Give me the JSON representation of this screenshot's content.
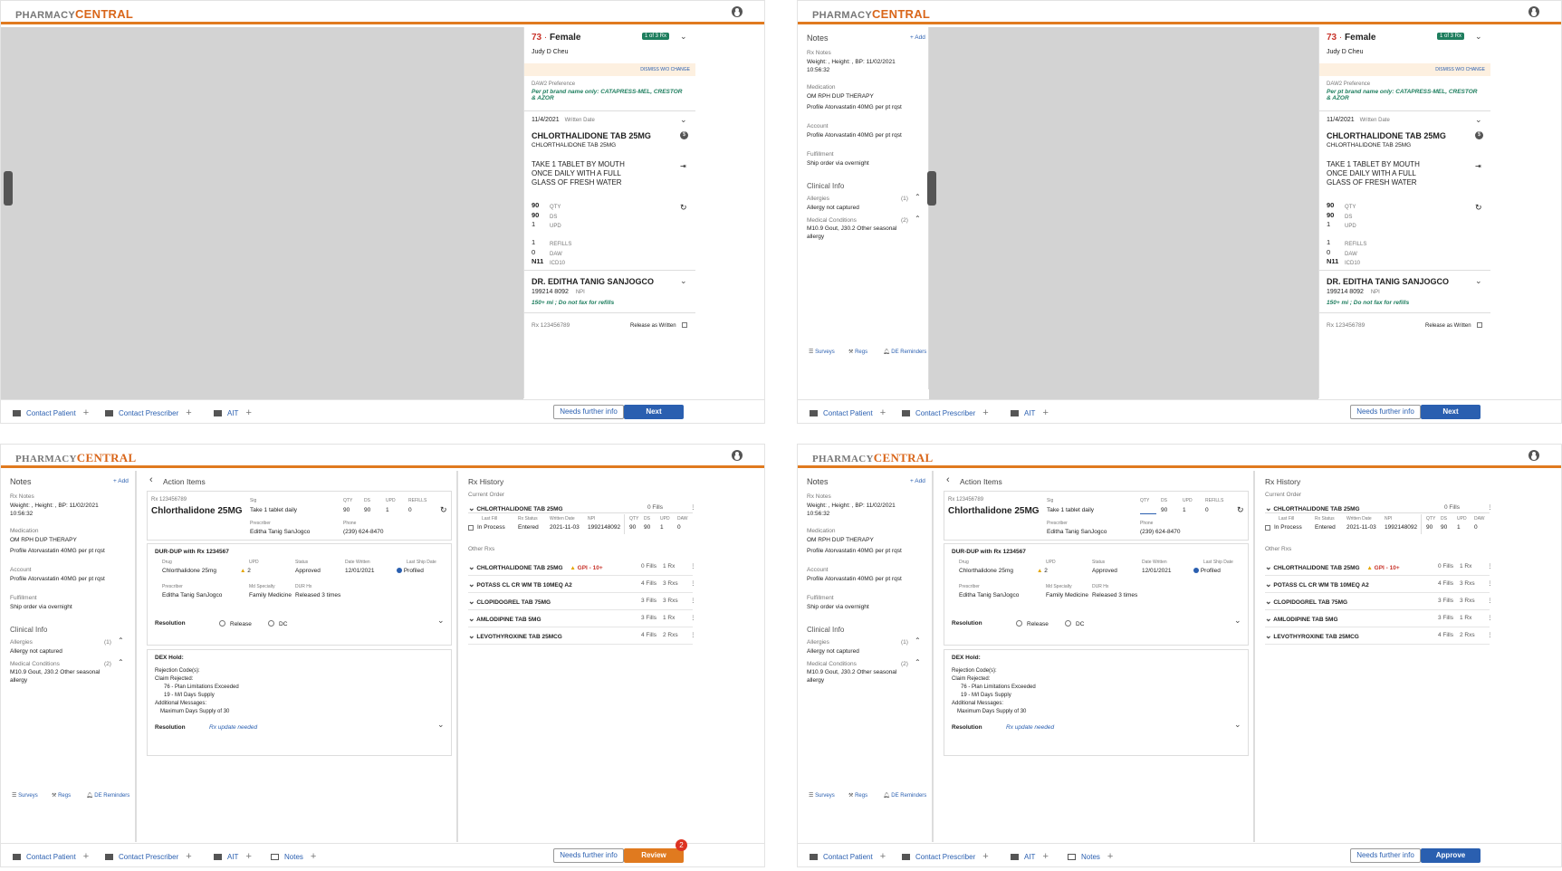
{
  "app": {
    "logo_a": "PHARMACY",
    "logo_b": "CENTRAL"
  },
  "colors": {
    "accent": "#e07a1f",
    "primary": "#2a5fb0",
    "review": "#e07a1f"
  },
  "patient": {
    "age": "73",
    "dot": "·",
    "gender": "Female",
    "rx_count": "1 of 3 Rx",
    "name": "Judy D Cheu",
    "dismiss": "DISMISS W/O CHANGE",
    "daw2_label": "DAW2 Preference",
    "daw2_text": "Per pt brand name only: CATAPRESS-MEL, CRESTOR & AZOR",
    "written_date": "11/4/2021",
    "written_label": "Written Date",
    "drug": "CHLORTHALIDONE TAB 25MG",
    "drug_sub": "CHLORTHALIDONE TAB 25MG",
    "sig": "TAKE 1 TABLET BY MOUTH ONCE DAILY WITH A FULL GLASS OF FRESH WATER",
    "qty": "90",
    "qty_l": "QTY",
    "ds": "90",
    "ds_l": "DS",
    "upd": "1",
    "upd_l": "UPD",
    "refills": "1",
    "refills_l": "REFILLS",
    "daw": "0",
    "daw_l": "DAW",
    "icd": "N11",
    "icd_l": "ICD10",
    "prescriber": "DR. EDITHA TANIG SANJOGCO",
    "npi": "199214 8092",
    "npi_l": "NPI",
    "presc_note": "150+ mi ;  Do not fax for refills",
    "rx_no": "Rx 123456789",
    "raw": "Release as Written"
  },
  "notes": {
    "title": "Notes",
    "add": "+ Add",
    "rx_notes_l": "Rx Notes",
    "rx_notes": "Weight: , Height: , BP: 11/02/2021 10:56:32",
    "med_l": "Medication",
    "med_1": "OM RPH DUP THERAPY",
    "med_2": "Profile Atorvastatin 40MG per pt rqst",
    "acct_l": "Account",
    "acct": "Profile Atorvastatin 40MG per pt rqst",
    "ful_l": "Fulfillment",
    "ful": "Ship order via overnight",
    "clin": "Clinical Info",
    "all_l": "Allergies",
    "all_c": "(1)",
    "all": "Allergy not captured",
    "mc_l": "Medical Conditions",
    "mc_c": "(2)",
    "mc": "M10.9 Gout, J30.2 Other seasonal allergy",
    "surveys": "Surveys",
    "regs": "Regs",
    "de": "DE Reminders"
  },
  "footer": {
    "contact_patient": "Contact Patient",
    "contact_prescriber": "Contact Prescriber",
    "ait": "AIT",
    "notes": "Notes",
    "needs": "Needs further info",
    "next": "Next",
    "review": "Review",
    "approve": "Approve",
    "review_badge": "2"
  },
  "action": {
    "title": "Action Items",
    "rx_no": "Rx 123456789",
    "drug": "Chlorthalidone 25MG",
    "sig_l": "Sig",
    "sig": "Take 1 tablet daily",
    "qty_l": "QTY",
    "qty": "90",
    "ds_l": "DS",
    "ds": "90",
    "upd_l": "UPD",
    "upd": "1",
    "refills_l": "REFILLS",
    "refills": "0",
    "presc_l": "Prescriber",
    "presc": "Editha Tanig SanJogco",
    "phone_l": "Phone",
    "phone": "(239) 624-8470",
    "dur_title": "DUR-DUP with Rx 1234567",
    "dur_drug_l": "Drug",
    "dur_drug": "Chlorthalidone 25mg",
    "dur_upd_l": "UPD",
    "dur_upd": "2",
    "dur_status_l": "Status",
    "dur_status": "Approved",
    "dur_dw_l": "Date Written",
    "dur_dw": "12/01/2021",
    "dur_ls_l": "Last Ship Date",
    "dur_ls": "Profiled",
    "dur_presc_l": "Prescriber",
    "dur_presc": "Editha Tanig SanJogco",
    "dur_spec_l": "Md Specialty",
    "dur_spec": "Family Medicine",
    "dur_hx_l": "DUR Hx",
    "dur_hx": "Released 3 times",
    "resolution": "Resolution",
    "release": "Release",
    "dc": "DC",
    "dex_title": "DEX Hold:",
    "dex_1": "Rejection Code(s):",
    "dex_2": "Claim Rejected:",
    "dex_3": "76 - Plan Limitations Exceeded",
    "dex_4": "19 - M/I Days Supply",
    "dex_5": "Additional Messages:",
    "dex_6": "Maximum Days Supply of 30",
    "dex_res": "Rx update needed"
  },
  "history": {
    "title": "Rx History",
    "current": "Current Order",
    "other": "Other Rxs",
    "cur_drug": "CHLORTHALIDONE TAB 25MG",
    "cur_fills": "0 Fills",
    "h_lastfill": "Last Fill",
    "h_status": "Rx Status",
    "h_written": "Written Date",
    "h_npi": "NPI",
    "h_qty": "QTY",
    "h_ds": "DS",
    "h_upd": "UPD",
    "h_daw": "DAW",
    "r_lastfill": "In Process",
    "r_status": "Entered",
    "r_written": "2021-11-03",
    "r_npi": "1992148092",
    "r_qty": "90",
    "r_ds": "90",
    "r_upd": "1",
    "r_daw": "0",
    "items": [
      {
        "drug": "CHLORTHALIDONE TAB 25MG",
        "flag": "GPI - 10+",
        "fills": "0 Fills",
        "rxs": "1 Rx"
      },
      {
        "drug": "POTASS CL CR WM TB 10MEQ A2",
        "flag": "",
        "fills": "4 Fills",
        "rxs": "3 Rxs"
      },
      {
        "drug": "CLOPIDOGREL TAB 75MG",
        "flag": "",
        "fills": "3 Fills",
        "rxs": "3 Rxs"
      },
      {
        "drug": "AMLODIPINE TAB 5MG",
        "flag": "",
        "fills": "3 Fills",
        "rxs": "1 Rx"
      },
      {
        "drug": "LEVOTHYROXINE TAB 25MCG",
        "flag": "",
        "fills": "4 Fills",
        "rxs": "2 Rxs"
      }
    ]
  }
}
